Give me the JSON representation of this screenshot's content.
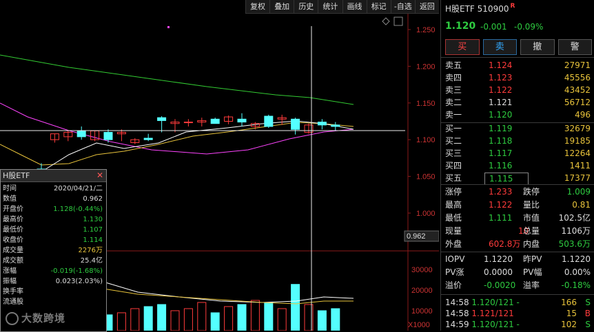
{
  "toolbar": [
    "复权",
    "叠加",
    "历史",
    "统计",
    "画线",
    "标记",
    "-自选",
    "返回"
  ],
  "stock": {
    "name": "H股ETF",
    "code": "510900",
    "badge": "R",
    "price": "1.120",
    "change": "-0.001",
    "change_pct": "-0.09%"
  },
  "trade_buttons": {
    "buy": "买",
    "sell": "卖",
    "cancel": "撤",
    "alert": "警"
  },
  "sell_book": [
    {
      "label": "卖五",
      "price": "1.124",
      "vol": "27971"
    },
    {
      "label": "卖四",
      "price": "1.123",
      "vol": "45556"
    },
    {
      "label": "卖三",
      "price": "1.122",
      "vol": "43452"
    },
    {
      "label": "卖二",
      "price": "1.121",
      "vol": "56712"
    },
    {
      "label": "卖一",
      "price": "1.120",
      "vol": "496"
    }
  ],
  "buy_book": [
    {
      "label": "买一",
      "price": "1.119",
      "vol": "32679"
    },
    {
      "label": "买二",
      "price": "1.118",
      "vol": "19185"
    },
    {
      "label": "买三",
      "price": "1.117",
      "vol": "12264"
    },
    {
      "label": "买四",
      "price": "1.116",
      "vol": "1411"
    },
    {
      "label": "买五",
      "price": "1.115",
      "vol": "17377"
    }
  ],
  "stats": {
    "zt_label": "涨停",
    "zt": "1.233",
    "dt_label": "跌停",
    "dt": "1.009",
    "high_label": "最高",
    "high": "1.122",
    "lb_label": "量比",
    "lb": "0.81",
    "low_label": "最低",
    "low": "1.111",
    "mv_label": "市值",
    "mv": "102.5亿",
    "cur_label": "现量",
    "cur": "10",
    "tv_label": "总量",
    "tv": "1106万",
    "out_label": "外盘",
    "out": "602.8万",
    "in_label": "内盘",
    "in": "503.6万"
  },
  "iopv": {
    "iopv_label": "IOPV",
    "iopv": "1.1220",
    "pre_label": "昨PV",
    "pre": "1.1220",
    "pvz_label": "PV涨",
    "pvz": "0.0000",
    "pvf_label": "PV幅",
    "pvf": "0.00%",
    "yj_label": "溢价",
    "yj": "-0.0020",
    "yjl_label": "溢率",
    "yjl": "-0.18%"
  },
  "ticks": [
    {
      "time": "14:58",
      "price": "1.120/121 -",
      "vol": "166",
      "dir": "S"
    },
    {
      "time": "14:58",
      "price": "1.121/121",
      "vol": "15",
      "dir": "B"
    },
    {
      "time": "14:59",
      "price": "1.120/121 -",
      "vol": "102",
      "dir": "S"
    }
  ],
  "y_axis": [
    "1.250",
    "1.200",
    "1.150",
    "1.100",
    "1.050",
    "1.000"
  ],
  "crosshair_value": "0.962",
  "vol_axis": [
    "30000",
    "20000",
    "10000"
  ],
  "vol_unit": "X1000",
  "tooltip": {
    "title": "H股ETF",
    "rows": [
      {
        "k": "时间",
        "v": "2020/04/21/二",
        "c": "#ddd"
      },
      {
        "k": "数值",
        "v": "0.962",
        "c": "#ddd"
      },
      {
        "k": "开盘价",
        "v": "1.128(-0.44%)",
        "c": "#2ecc40"
      },
      {
        "k": "最高价",
        "v": "1.130",
        "c": "#2ecc40"
      },
      {
        "k": "最低价",
        "v": "1.107",
        "c": "#2ecc40"
      },
      {
        "k": "收盘价",
        "v": "1.114",
        "c": "#2ecc40"
      },
      {
        "k": "成交量",
        "v": "2276万",
        "c": "#e8c33b"
      },
      {
        "k": "成交额",
        "v": "25.4亿",
        "c": "#ddd"
      },
      {
        "k": "涨幅",
        "v": "-0.019(-1.68%)",
        "c": "#2ecc40"
      },
      {
        "k": "振幅",
        "v": "0.023(2.03%)",
        "c": "#ddd"
      },
      {
        "k": "换手率",
        "v": "",
        "c": "#ddd"
      },
      {
        "k": "流通股",
        "v": "",
        "c": "#ddd"
      }
    ]
  },
  "watermark": "大数跨境",
  "colors": {
    "up": "#ff3b3b",
    "down": "#54ffff",
    "ma5": "#ffffff",
    "ma10": "#e8c33b",
    "ma20": "#ff44ff",
    "ma60": "#33cc33"
  },
  "chart_data": {
    "type": "candlestick",
    "price_range": [
      0.96,
      1.26
    ],
    "candles": [
      {
        "o": 1.06,
        "h": 1.068,
        "l": 1.03,
        "c": 1.04
      },
      {
        "o": 1.1,
        "h": 1.108,
        "l": 1.096,
        "c": 1.108
      },
      {
        "o": 1.104,
        "h": 1.112,
        "l": 1.098,
        "c": 1.11
      },
      {
        "o": 1.112,
        "h": 1.118,
        "l": 1.1,
        "c": 1.104
      },
      {
        "o": 1.1,
        "h": 1.112,
        "l": 1.098,
        "c": 1.112
      },
      {
        "o": 1.11,
        "h": 1.114,
        "l": 1.096,
        "c": 1.1
      },
      {
        "o": 1.108,
        "h": 1.114,
        "l": 1.098,
        "c": 1.11
      },
      {
        "o": 1.096,
        "h": 1.102,
        "l": 1.094,
        "c": 1.1
      },
      {
        "o": 1.102,
        "h": 1.108,
        "l": 1.098,
        "c": 1.1
      },
      {
        "o": 1.13,
        "h": 1.132,
        "l": 1.11,
        "c": 1.126
      },
      {
        "o": 1.122,
        "h": 1.128,
        "l": 1.11,
        "c": 1.124
      },
      {
        "o": 1.124,
        "h": 1.128,
        "l": 1.118,
        "c": 1.124
      },
      {
        "o": 1.124,
        "h": 1.13,
        "l": 1.118,
        "c": 1.126
      },
      {
        "o": 1.128,
        "h": 1.13,
        "l": 1.126,
        "c": 1.122
      },
      {
        "o": 1.125,
        "h": 1.133,
        "l": 1.121,
        "c": 1.131
      },
      {
        "o": 1.128,
        "h": 1.136,
        "l": 1.118,
        "c": 1.124
      },
      {
        "o": 1.118,
        "h": 1.124,
        "l": 1.114,
        "c": 1.122
      },
      {
        "o": 1.132,
        "h": 1.134,
        "l": 1.116,
        "c": 1.118
      },
      {
        "o": 1.128,
        "h": 1.134,
        "l": 1.12,
        "c": 1.13
      },
      {
        "o": 1.128,
        "h": 1.13,
        "l": 1.107,
        "c": 1.114
      },
      {
        "o": 1.11,
        "h": 1.122,
        "l": 1.108,
        "c": 1.12
      },
      {
        "o": 1.124,
        "h": 1.128,
        "l": 1.114,
        "c": 1.12
      },
      {
        "o": 1.12,
        "h": 1.124,
        "l": 1.112,
        "c": 1.118
      }
    ],
    "volume": [
      14000,
      10000,
      12000,
      9000,
      10000,
      8000,
      9000,
      11000,
      12000,
      13000,
      10000,
      11000,
      14000,
      9000,
      12000,
      13000,
      15000,
      14000,
      11000,
      22760,
      13000,
      10000,
      11000
    ]
  }
}
